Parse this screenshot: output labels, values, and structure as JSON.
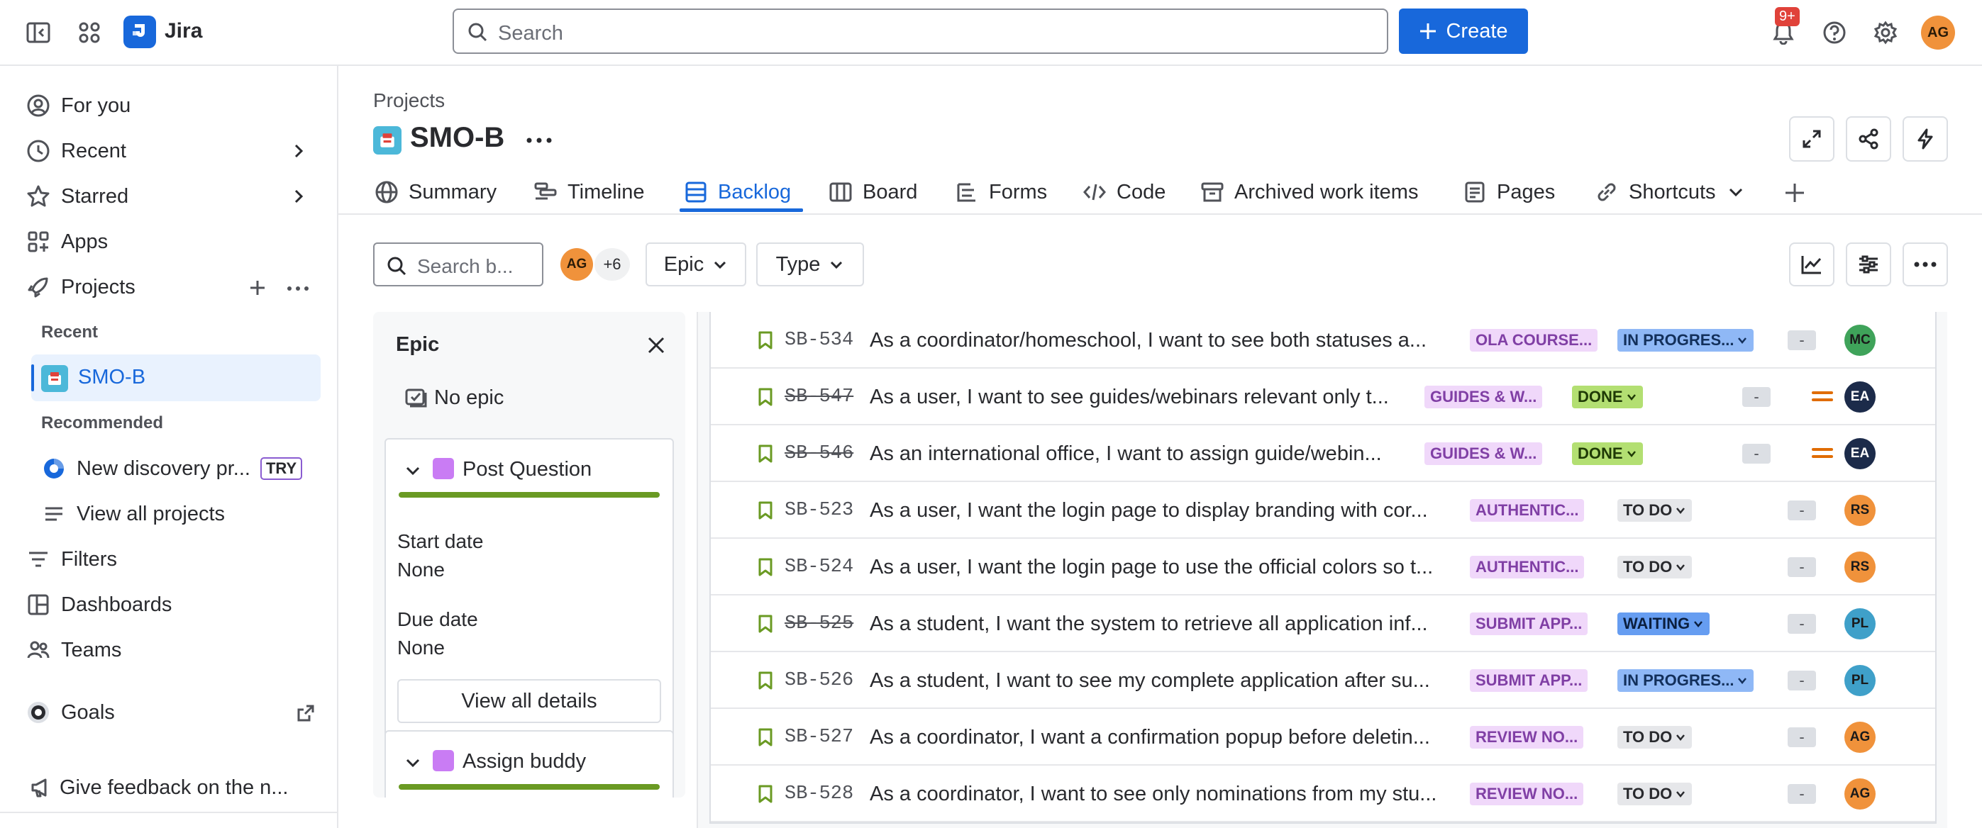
{
  "topbar": {
    "app_name": "Jira",
    "search_placeholder": "Search",
    "create_label": "Create",
    "notif_count": "9+",
    "user_initials": "AG"
  },
  "sidebar": {
    "for_you": "For you",
    "recent": "Recent",
    "starred": "Starred",
    "apps": "Apps",
    "projects": "Projects",
    "recent_header": "Recent",
    "recent_project": "SMO-B",
    "recommended_header": "Recommended",
    "new_discovery": "New discovery pr...",
    "try_badge": "TRY",
    "view_all_projects": "View all projects",
    "filters": "Filters",
    "dashboards": "Dashboards",
    "teams": "Teams",
    "goals": "Goals",
    "feedback": "Give feedback on the n..."
  },
  "header": {
    "breadcrumb": "Projects",
    "project_title": "SMO-B",
    "tabs": [
      {
        "label": "Summary"
      },
      {
        "label": "Timeline"
      },
      {
        "label": "Backlog"
      },
      {
        "label": "Board"
      },
      {
        "label": "Forms"
      },
      {
        "label": "Code"
      },
      {
        "label": "Archived work items"
      },
      {
        "label": "Pages"
      },
      {
        "label": "Shortcuts"
      }
    ]
  },
  "toolbar": {
    "search_placeholder": "Search b...",
    "avatar_initials": "AG",
    "more_count": "+6",
    "epic_filter": "Epic",
    "type_filter": "Type"
  },
  "epic_panel": {
    "title": "Epic",
    "no_epic": "No epic",
    "epics": [
      {
        "name": "Post Question",
        "start_label": "Start date",
        "start_value": "None",
        "due_label": "Due date",
        "due_value": "None",
        "details_button": "View all details"
      },
      {
        "name": "Assign buddy"
      }
    ]
  },
  "issues": [
    {
      "key": "SB-534",
      "done": false,
      "summary": "As a coordinator/homeschool, I want to see both statuses a...",
      "epic": "OLA COURSE...",
      "status": "IN PROGRES...",
      "status_type": "progress",
      "estimate": "-",
      "priority": false,
      "assignee": "MC",
      "assignee_color": "#3fa35a"
    },
    {
      "key": "SB-547",
      "done": true,
      "summary": "As a user, I want to see guides/webinars relevant only t...",
      "epic": "GUIDES & W...",
      "status": "DONE",
      "status_type": "done",
      "estimate": "-",
      "priority": true,
      "assignee": "EA",
      "assignee_color": "#1c2b4a"
    },
    {
      "key": "SB-546",
      "done": true,
      "summary": "As an international office, I want to assign guide/webin...",
      "epic": "GUIDES & W...",
      "status": "DONE",
      "status_type": "done",
      "estimate": "-",
      "priority": true,
      "assignee": "EA",
      "assignee_color": "#1c2b4a"
    },
    {
      "key": "SB-523",
      "done": false,
      "summary": "As a user, I want the login page to display branding with cor...",
      "epic": "AUTHENTIC...",
      "status": "TO DO",
      "status_type": "todo",
      "estimate": "-",
      "priority": false,
      "assignee": "RS",
      "assignee_color": "#f0923b"
    },
    {
      "key": "SB-524",
      "done": false,
      "summary": "As a user, I want the login page to use the official colors so t...",
      "epic": "AUTHENTIC...",
      "status": "TO DO",
      "status_type": "todo",
      "estimate": "-",
      "priority": false,
      "assignee": "RS",
      "assignee_color": "#f0923b"
    },
    {
      "key": "SB-525",
      "done": true,
      "summary": "As a student, I want the system to retrieve all application inf...",
      "epic": "SUBMIT APP...",
      "status": "WAITING",
      "status_type": "waiting",
      "estimate": "-",
      "priority": false,
      "assignee": "PL",
      "assignee_color": "#3fa0c9"
    },
    {
      "key": "SB-526",
      "done": false,
      "summary": "As a student, I want to see my complete application after su...",
      "epic": "SUBMIT APP...",
      "status": "IN PROGRES...",
      "status_type": "progress",
      "estimate": "-",
      "priority": false,
      "assignee": "PL",
      "assignee_color": "#3fa0c9"
    },
    {
      "key": "SB-527",
      "done": false,
      "summary": "As a coordinator, I want a confirmation popup before deletin...",
      "epic": "REVIEW NO...",
      "status": "TO DO",
      "status_type": "todo",
      "estimate": "-",
      "priority": false,
      "assignee": "AG",
      "assignee_color": "#f0923b"
    },
    {
      "key": "SB-528",
      "done": false,
      "summary": "As a coordinator, I want to see only nominations from my stu...",
      "epic": "REVIEW NO...",
      "status": "TO DO",
      "status_type": "todo",
      "estimate": "-",
      "priority": false,
      "assignee": "AG",
      "assignee_color": "#f0923b"
    }
  ]
}
